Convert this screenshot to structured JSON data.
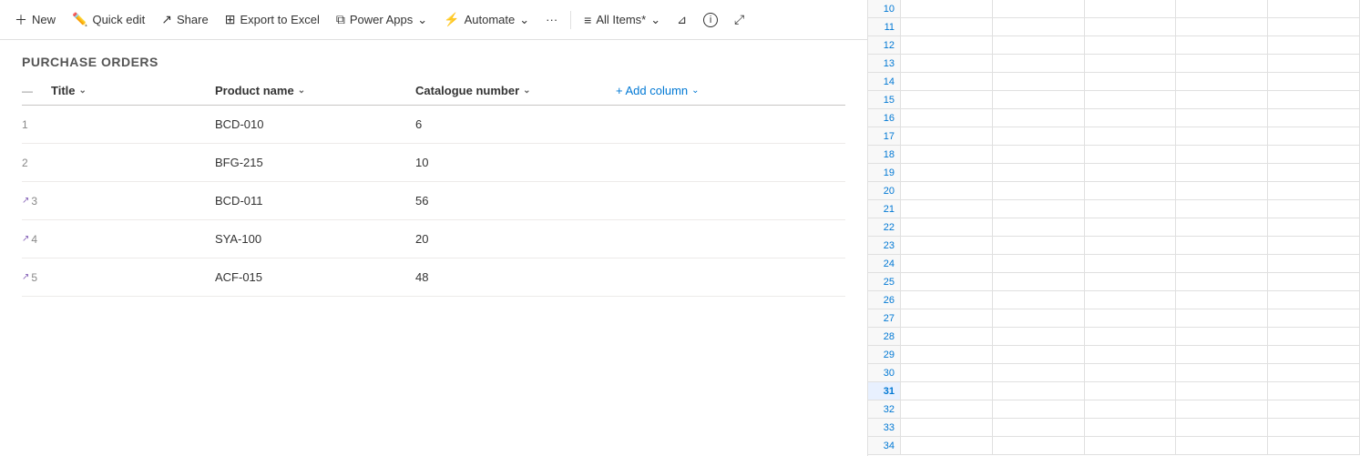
{
  "toolbar": {
    "new_label": "New",
    "quick_edit_label": "Quick edit",
    "share_label": "Share",
    "export_label": "Export to Excel",
    "power_apps_label": "Power Apps",
    "automate_label": "Automate",
    "more_label": "···",
    "view_label": "All Items*",
    "filter_icon": "filter",
    "info_icon": "info",
    "expand_icon": "expand"
  },
  "page": {
    "title": "PURCHASE ORDERS"
  },
  "columns": {
    "title_label": "Title",
    "product_label": "Product name",
    "catalogue_label": "Catalogue number",
    "add_label": "+ Add column"
  },
  "rows": [
    {
      "num": "1",
      "icon": false,
      "product": "BCD-010",
      "catalogue": "6"
    },
    {
      "num": "2",
      "icon": false,
      "product": "BFG-215",
      "catalogue": "10"
    },
    {
      "num": "3",
      "icon": true,
      "product": "BCD-011",
      "catalogue": "56"
    },
    {
      "num": "4",
      "icon": true,
      "product": "SYA-100",
      "catalogue": "20"
    },
    {
      "num": "5",
      "icon": true,
      "product": "ACF-015",
      "catalogue": "48"
    }
  ],
  "spreadsheet": {
    "rows": [
      10,
      11,
      12,
      13,
      14,
      15,
      16,
      17,
      18,
      19,
      20,
      21,
      22,
      23,
      24,
      25,
      26,
      27,
      28,
      29,
      30,
      31,
      32,
      33,
      34
    ],
    "highlighted": [
      31
    ]
  },
  "colors": {
    "accent": "#0078d4",
    "icon_purple": "#8764b8",
    "border": "#e0e0e0",
    "text_muted": "#888"
  }
}
